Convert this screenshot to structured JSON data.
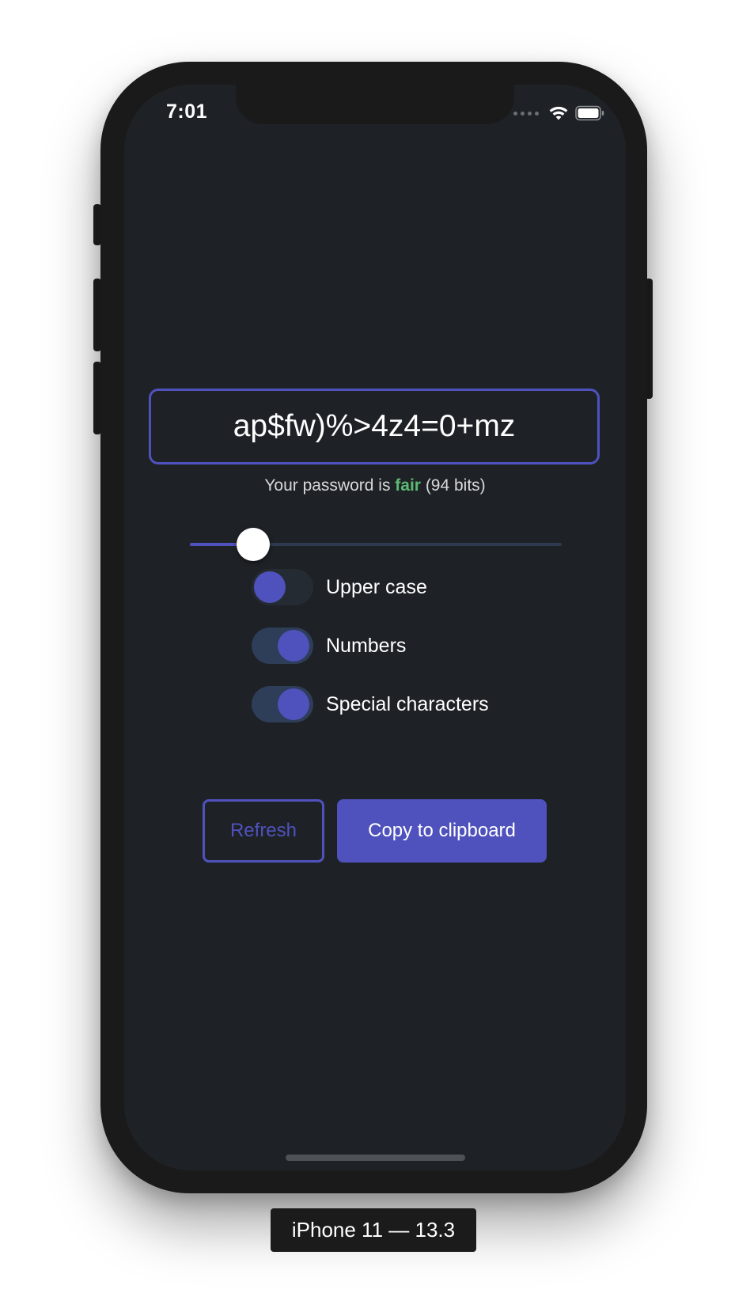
{
  "status_bar": {
    "time": "7:01",
    "icons": [
      "signal-dots-icon",
      "wifi-icon",
      "battery-icon"
    ]
  },
  "password": {
    "value": "ap$fw)%>4z4=0+mz"
  },
  "strength": {
    "prefix": "Your password is ",
    "rating": "fair",
    "suffix": " (94 bits)"
  },
  "length_slider": {
    "fraction": 0.17
  },
  "options": [
    {
      "label": "Upper case",
      "enabled": false
    },
    {
      "label": "Numbers",
      "enabled": true
    },
    {
      "label": "Special characters",
      "enabled": true
    }
  ],
  "actions": {
    "refresh_label": "Refresh",
    "copy_label": "Copy to clipboard"
  },
  "device_label": "iPhone 11 — 13.3",
  "colors": {
    "accent": "#4f52bd",
    "fair": "#5cb873",
    "screen_bg": "#1e2226"
  }
}
